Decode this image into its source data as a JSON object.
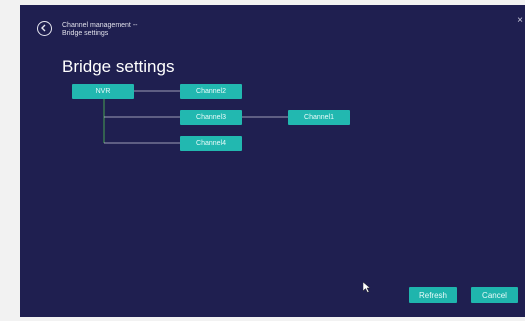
{
  "header": {
    "breadcrumb_line1": "Channel management --",
    "breadcrumb_line2": "Bridge settings",
    "title": "Bridge settings"
  },
  "topology": {
    "root": "NVR",
    "channel2": "Channel2",
    "channel3": "Channel3",
    "channel4": "Channel4",
    "channel1": "Channel1"
  },
  "footer": {
    "refresh_label": "Refresh",
    "cancel_label": "Cancel"
  },
  "colors": {
    "background": "#1f1f50",
    "node": "#22b8b0",
    "link_root": "#4caf50",
    "link": "#c8c8d8"
  }
}
